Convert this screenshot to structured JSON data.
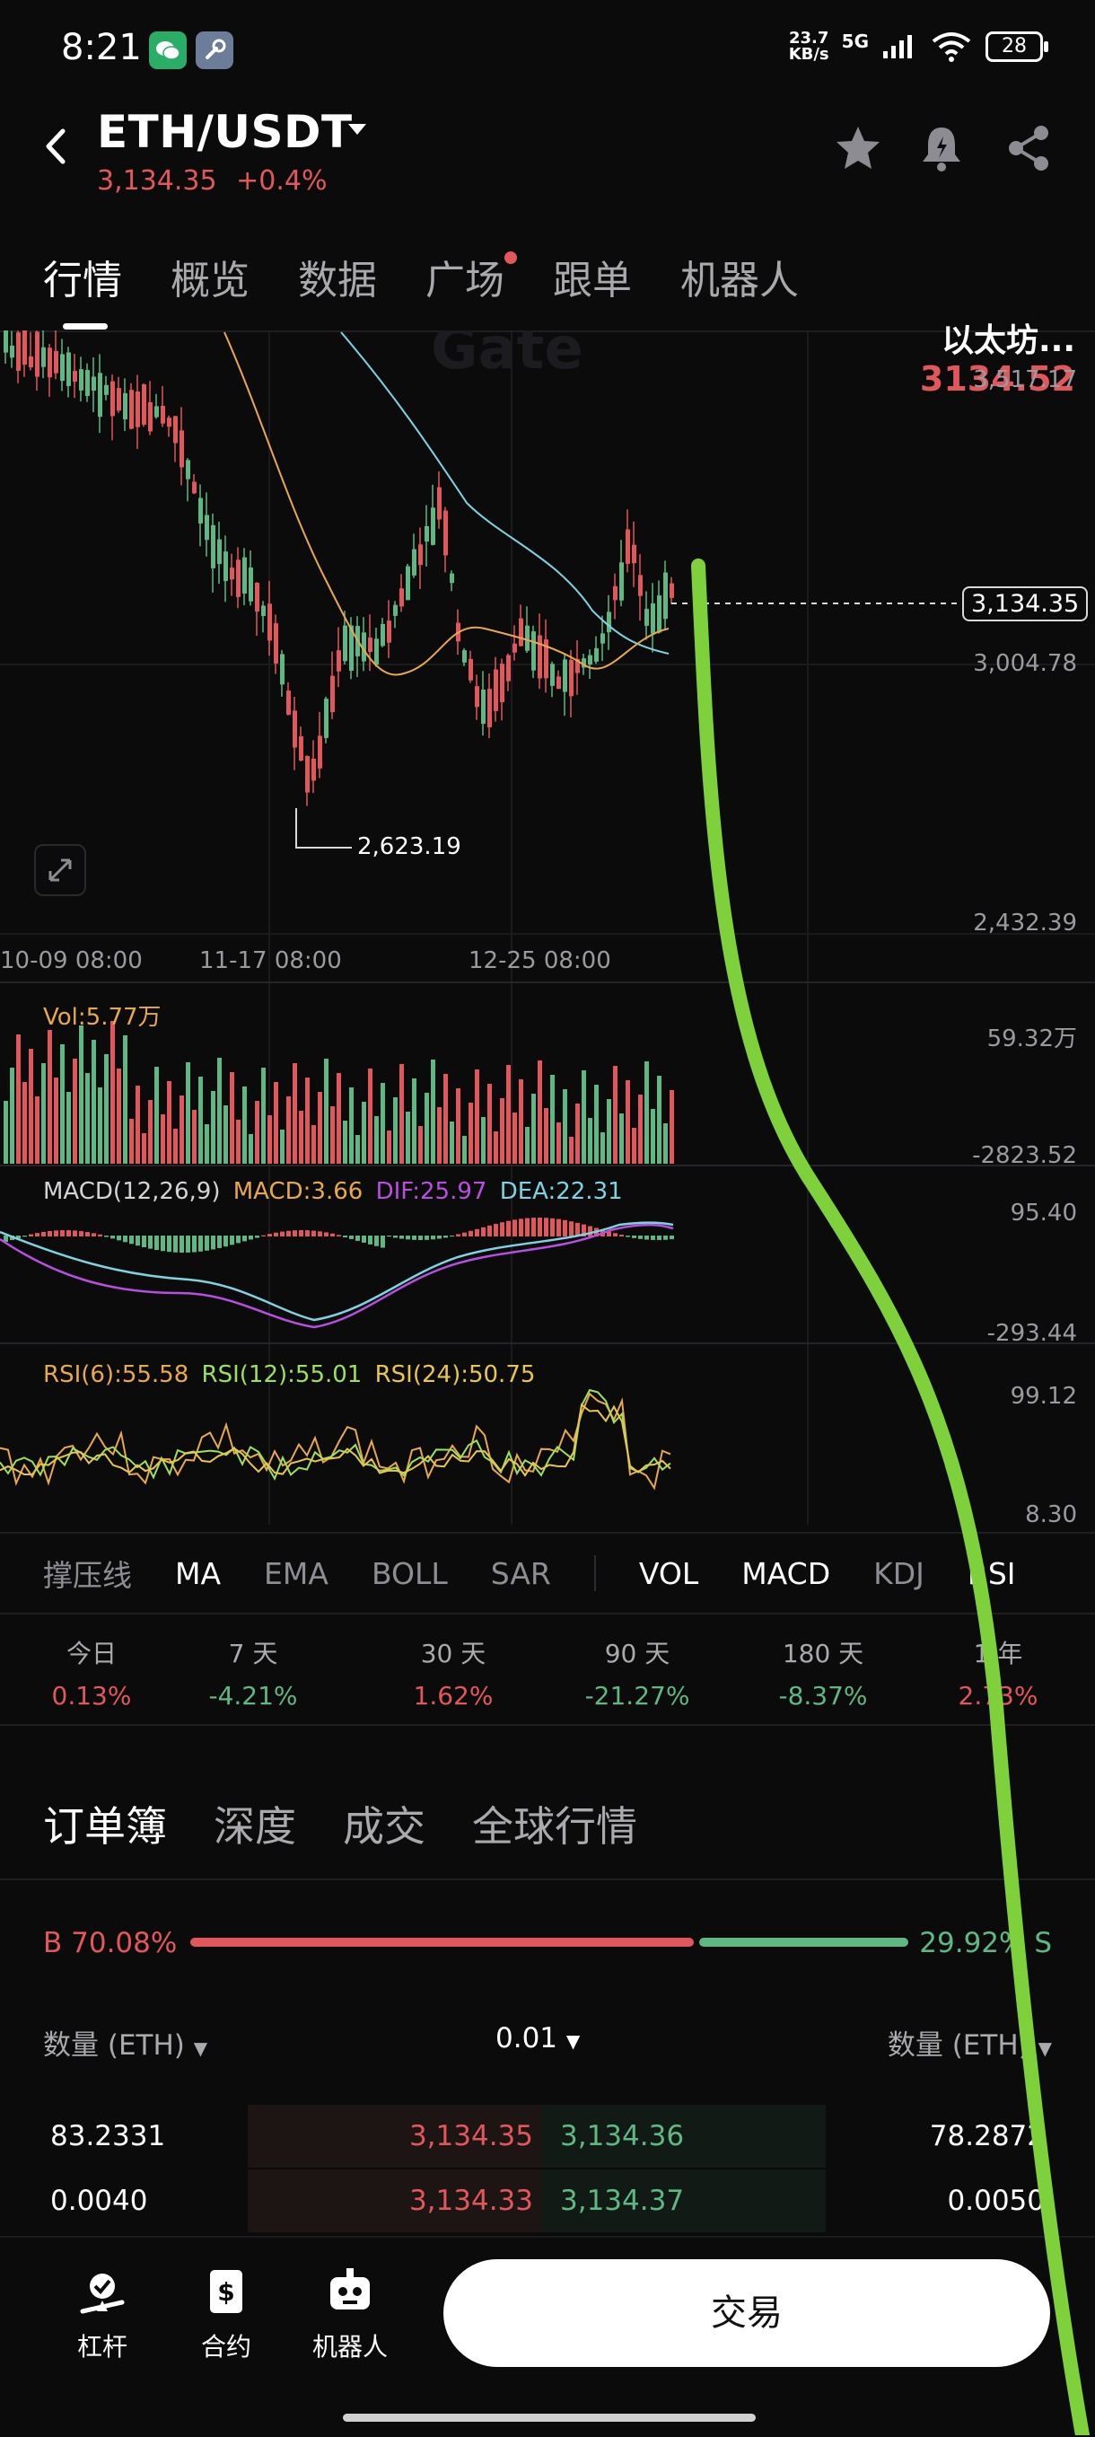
{
  "status_bar": {
    "time": "8:21",
    "net_speed_top": "23.7",
    "net_speed_unit": "KB/s",
    "network": "5G",
    "battery": "28"
  },
  "header": {
    "pair": "ETH/USDT",
    "last_price": "3,134.35",
    "change": "+0.4%"
  },
  "tabs": [
    "行情",
    "概览",
    "数据",
    "广场",
    "跟单",
    "机器人"
  ],
  "chart": {
    "coin_name": "以太坊...",
    "coin_price": "3134.52",
    "watermark": "Gate",
    "y_labels": [
      "3,517.17",
      "3,004.78",
      "2,432.39"
    ],
    "current_price_tag": "3,134.35",
    "low_marker": "2,623.19",
    "x_labels": [
      "10-09 08:00",
      "11-17 08:00",
      "12-25 08:00"
    ]
  },
  "chart_data": {
    "type": "candlestick",
    "y_axis_ticks": [
      3517.17,
      3004.78,
      2432.39
    ],
    "last_price": 3134.35,
    "low_marked": 2623.19,
    "x_ticks": [
      "10-09 08:00",
      "11-17 08:00",
      "12-25 08:00"
    ],
    "volume": {
      "label": "Vol:5.77万",
      "y_ticks": [
        "59.32万",
        "-2823.52"
      ]
    },
    "macd": {
      "params": "MACD(12,26,9)",
      "macd": "MACD:3.66",
      "dif": "DIF:25.97",
      "dea": "DEA:22.31",
      "y_ticks": [
        "95.40",
        "-293.44"
      ]
    },
    "rsi": {
      "rsi6": "RSI(6):55.58",
      "rsi12": "RSI(12):55.01",
      "rsi24": "RSI(24):50.75",
      "y_ticks": [
        "99.12",
        "8.30"
      ]
    }
  },
  "indicator_tabs": [
    "撑压线",
    "MA",
    "EMA",
    "BOLL",
    "SAR",
    "VOL",
    "MACD",
    "KDJ",
    "RSI"
  ],
  "periods": [
    {
      "label": "今日",
      "value": "0.13%",
      "dir": "up"
    },
    {
      "label": "7 天",
      "value": "-4.21%",
      "dir": "down"
    },
    {
      "label": "30 天",
      "value": "1.62%",
      "dir": "up"
    },
    {
      "label": "90 天",
      "value": "-21.27%",
      "dir": "down"
    },
    {
      "label": "180 天",
      "value": "-8.37%",
      "dir": "down"
    },
    {
      "label": "1 年",
      "value": "2.73%",
      "dir": "up"
    }
  ],
  "orderbook": {
    "tabs": [
      "订单簿",
      "深度",
      "成交",
      "全球行情"
    ],
    "buy_ratio": "B 70.08%",
    "sell_ratio": "29.92% S",
    "buy_fraction": 0.7008,
    "col_left": "数量 (ETH)",
    "precision": "0.01",
    "col_right": "数量 (ETH)",
    "rows": [
      {
        "bid_qty": "83.2331",
        "bid_price": "3,134.35",
        "ask_price": "3,134.36",
        "ask_qty": "78.2872"
      },
      {
        "bid_qty": "0.0040",
        "bid_price": "3,134.33",
        "ask_price": "3,134.37",
        "ask_qty": "0.0050"
      }
    ]
  },
  "bottom_nav": {
    "items": [
      "杠杆",
      "合约",
      "机器人"
    ],
    "trade": "交易"
  },
  "colors": {
    "up": "#e2575b",
    "down": "#5fb883",
    "annotation": "#7fd13b"
  }
}
